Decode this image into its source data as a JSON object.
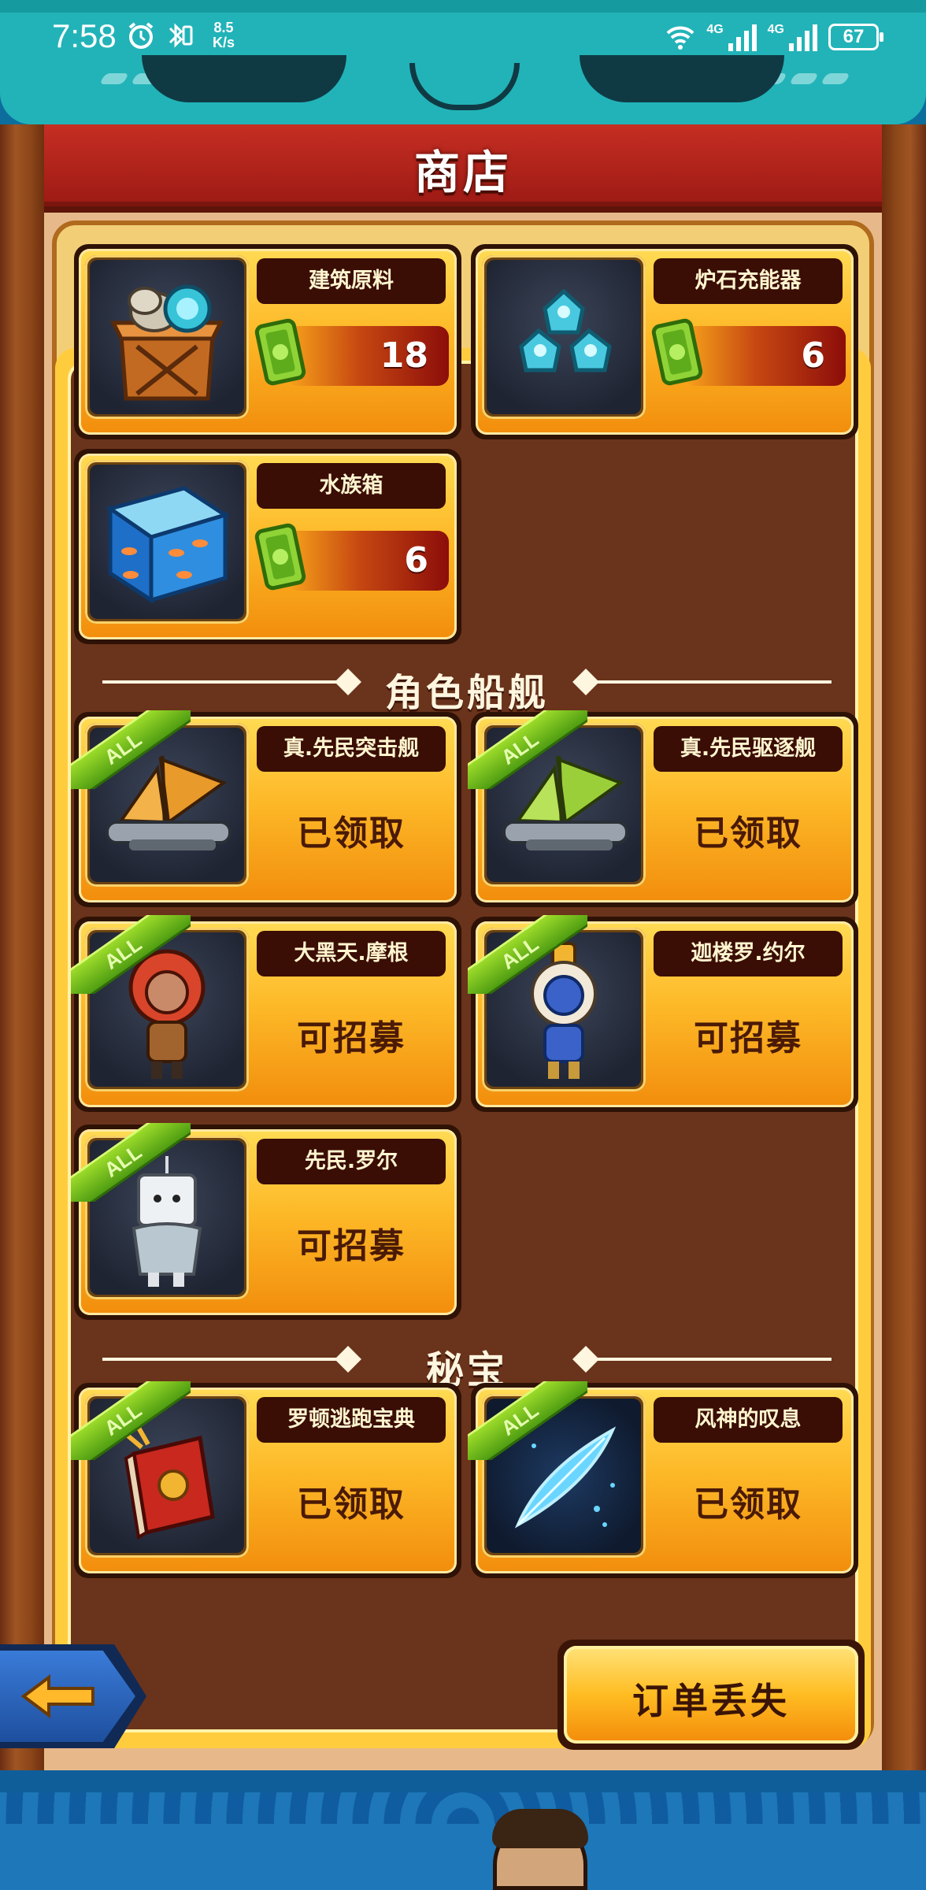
{
  "status_bar": {
    "time": "7:58",
    "net_speed_value": "8.5",
    "net_speed_unit": "K/s",
    "sig1_label": "4G",
    "sig2_label": "4G",
    "battery": "67"
  },
  "shop": {
    "title": "商店"
  },
  "resources": [
    {
      "name": "建筑原料",
      "price": "18",
      "icon": "crate-icon"
    },
    {
      "name": "炉石充能器",
      "price": "6",
      "icon": "crystal-icon"
    },
    {
      "name": "水族箱",
      "price": "6",
      "icon": "aquarium-icon"
    }
  ],
  "sections": {
    "characters_ships": "角色船舰",
    "treasures": "秘宝"
  },
  "ribbon_label": "ALL",
  "characters": [
    {
      "name": "真.先民突击舰",
      "status": "已领取",
      "icon": "ship-orange-icon"
    },
    {
      "name": "真.先民驱逐舰",
      "status": "已领取",
      "icon": "ship-green-icon"
    },
    {
      "name": "大黑天.摩根",
      "status": "可招募",
      "icon": "hero-red-icon"
    },
    {
      "name": "迦楼罗.约尔",
      "status": "可招募",
      "icon": "hero-blue-icon"
    },
    {
      "name": "先民.罗尔",
      "status": "可招募",
      "icon": "hero-robot-icon"
    }
  ],
  "treasures": [
    {
      "name": "罗顿逃跑宝典",
      "status": "已领取",
      "icon": "book-icon"
    },
    {
      "name": "风神的叹息",
      "status": "已领取",
      "icon": "feather-icon"
    }
  ],
  "buttons": {
    "order_lost": "订单丢失"
  },
  "colors": {
    "title_banner": "#b3231b",
    "card_gold": "#fdb928",
    "content_bg": "#6a331b",
    "ribbon_green": "#6fb81a",
    "back_button": "#2a63b8"
  }
}
